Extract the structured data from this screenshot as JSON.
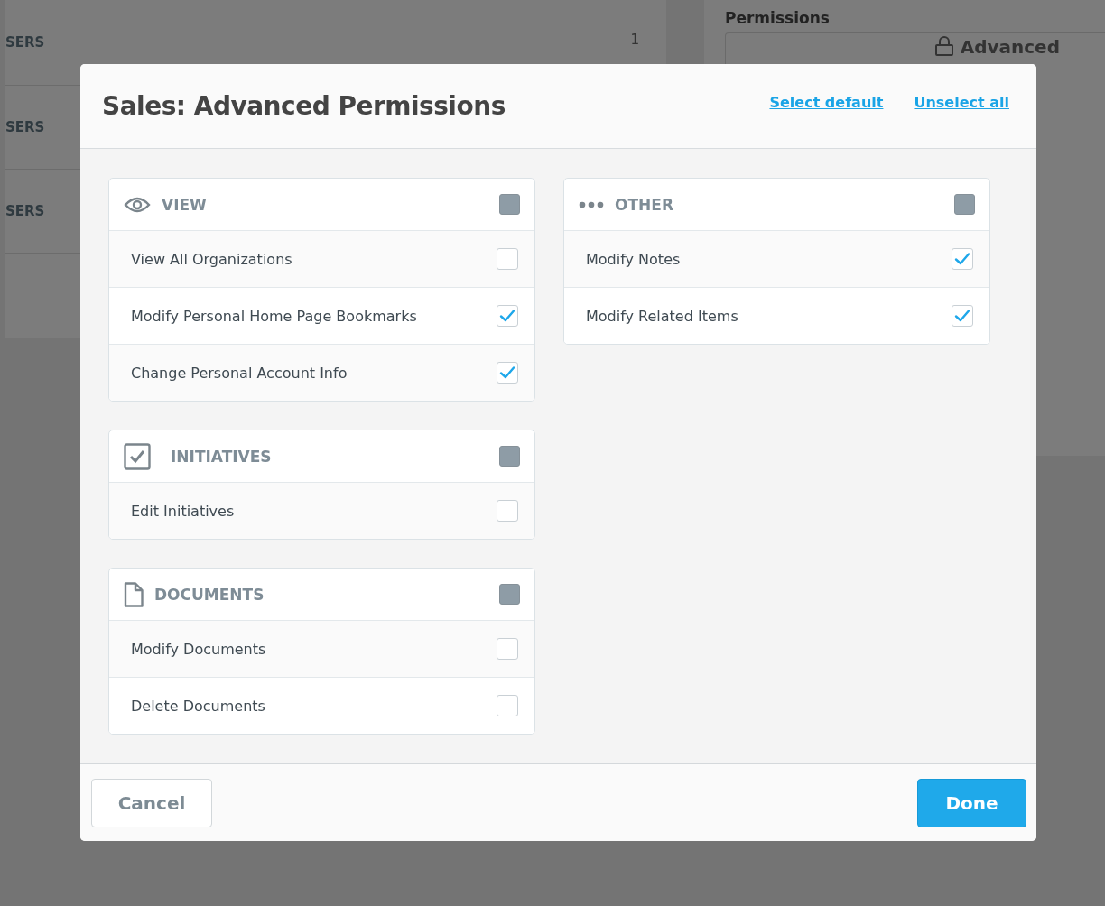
{
  "background": {
    "rows": [
      {
        "label": "SERS",
        "count": "1"
      },
      {
        "label": "SERS"
      },
      {
        "label": "SERS"
      }
    ],
    "side_panel": {
      "title": "Permissions",
      "field_value": "Advanced"
    }
  },
  "dialog": {
    "title": "Sales: Advanced Permissions",
    "links": [
      "Select default",
      "Unselect all"
    ],
    "columns": [
      [
        {
          "kind": "view",
          "title": "VIEW",
          "mixed": true,
          "items": [
            {
              "label": "View All Organizations",
              "checked": false
            },
            {
              "label": "Modify Personal Home Page Bookmarks",
              "checked": true
            },
            {
              "label": "Change Personal Account Info",
              "checked": true
            }
          ]
        },
        {
          "kind": "initiatives",
          "title": "INITIATIVES",
          "mixed": true,
          "items": [
            {
              "label": "Edit Initiatives",
              "checked": false
            }
          ]
        },
        {
          "kind": "documents",
          "title": "DOCUMENTS",
          "mixed": true,
          "items": [
            {
              "label": "Modify Documents",
              "checked": false
            },
            {
              "label": "Delete Documents",
              "checked": false
            }
          ]
        }
      ],
      [
        {
          "kind": "other",
          "title": "OTHER",
          "mixed": true,
          "items": [
            {
              "label": "Modify Notes",
              "checked": true
            },
            {
              "label": "Modify Related Items",
              "checked": true
            }
          ]
        }
      ]
    ],
    "cancel": "Cancel",
    "done": "Done"
  }
}
